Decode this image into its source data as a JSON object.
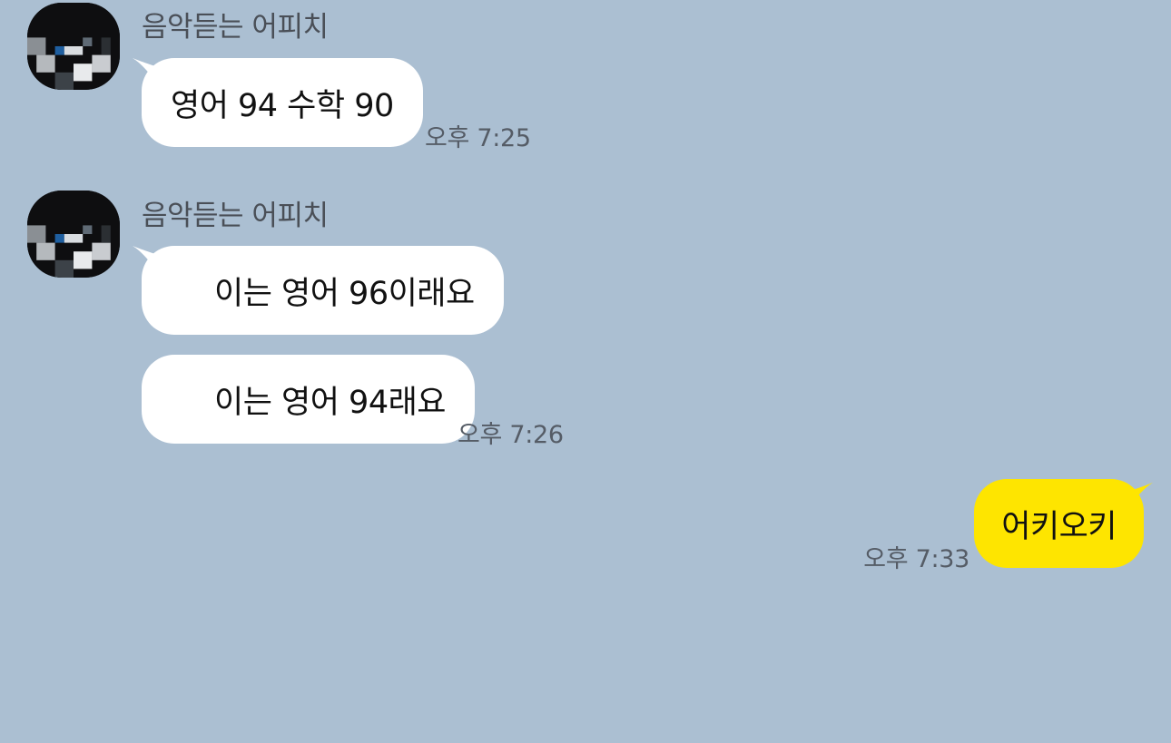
{
  "chat": {
    "groups": [
      {
        "sender": "음악듣는 어피치",
        "avatar": "pixelated-profile-photo",
        "messages": [
          {
            "text": "영어 94 수학 90"
          }
        ],
        "time": "오후 7:25"
      },
      {
        "sender": "음악듣는 어피치",
        "avatar": "pixelated-profile-photo",
        "messages": [
          {
            "text": "이는 영어 96이래요",
            "obscured_prefix": true
          },
          {
            "text": "이는 영어 94래요",
            "obscured_prefix": true
          }
        ],
        "time": "오후 7:26"
      }
    ],
    "outgoing": {
      "text": "어키오키",
      "time": "오후 7:33"
    }
  },
  "colors": {
    "background": "#abbfd2",
    "incoming_bubble": "#ffffff",
    "outgoing_bubble": "#fee500"
  }
}
